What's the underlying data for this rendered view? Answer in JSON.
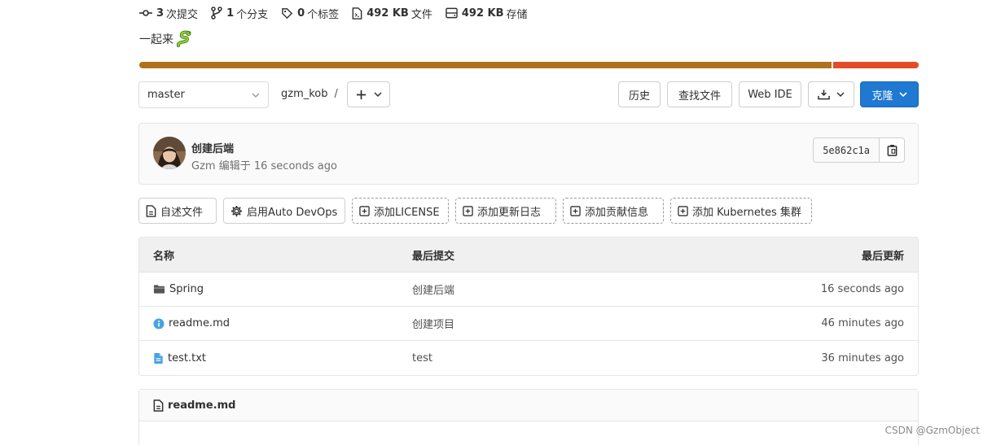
{
  "stats": [
    {
      "icon": "commit-icon",
      "count": "3",
      "label": "次提交"
    },
    {
      "icon": "branch-icon",
      "count": "1",
      "label": "个分支"
    },
    {
      "icon": "tag-icon",
      "count": "0",
      "label": "个标签"
    },
    {
      "icon": "file-size-icon",
      "count": "492 KB",
      "label": "文件"
    },
    {
      "icon": "storage-icon",
      "count": "492 KB",
      "label": "存储"
    }
  ],
  "description": "一起来",
  "language_bar": {
    "segments": [
      {
        "fraction": 0.89,
        "color": "#b07219"
      },
      {
        "fraction": 0.11,
        "color": "#e34c26"
      }
    ]
  },
  "toolbar": {
    "branch": "master",
    "breadcrumb": "gzm_kob",
    "breadcrumb_sep": "/",
    "history": "历史",
    "find_file": "查找文件",
    "web_ide": "Web IDE",
    "clone": "克隆"
  },
  "commit": {
    "title": "创建后端",
    "author": "Gzm",
    "verb": "编辑于",
    "time": "16 seconds ago",
    "sha": "5e862c1a"
  },
  "actions": [
    {
      "label": "自述文件",
      "icon": "file-icon",
      "style": "solid"
    },
    {
      "label": "启用Auto DevOps",
      "icon": "gear-icon",
      "style": "solid"
    },
    {
      "label": "添加LICENSE",
      "icon": "plus-square-icon",
      "style": "dashed"
    },
    {
      "label": "添加更新日志",
      "icon": "plus-square-icon",
      "style": "dashed"
    },
    {
      "label": "添加贡献信息",
      "icon": "plus-square-icon",
      "style": "dashed"
    },
    {
      "label": "添加 Kubernetes 集群",
      "icon": "plus-square-icon",
      "style": "dashed"
    }
  ],
  "tree": {
    "headers": {
      "name": "名称",
      "last_commit": "最后提交",
      "last_update": "最后更新"
    },
    "rows": [
      {
        "name": "Spring",
        "icon": "folder-icon",
        "commit": "创建后端",
        "updated": "16 seconds ago"
      },
      {
        "name": "readme.md",
        "icon": "info-icon",
        "commit": "创建项目",
        "updated": "46 minutes ago"
      },
      {
        "name": "test.txt",
        "icon": "text-file-icon",
        "commit": "test",
        "updated": "36 minutes ago"
      }
    ]
  },
  "readme": {
    "title": "readme.md"
  },
  "watermark": "CSDN @GzmObject"
}
